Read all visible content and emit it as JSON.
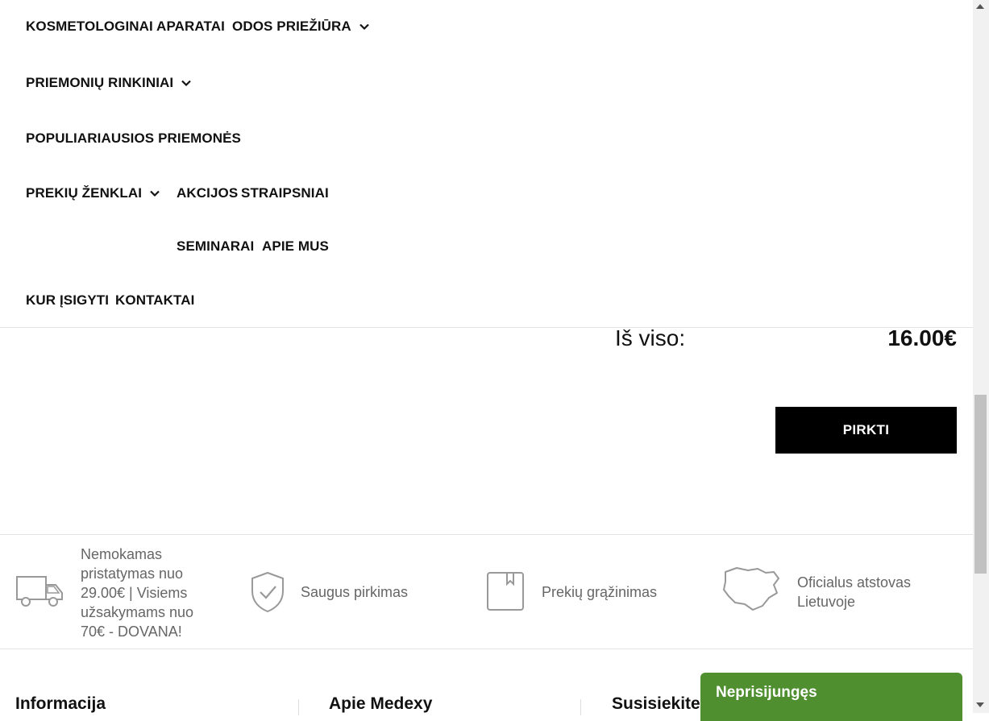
{
  "nav": {
    "items": [
      {
        "label": "KOSMETOLOGINAI APARATAI"
      },
      {
        "label": "ODOS PRIEŽIŪRA"
      },
      {
        "label": "PRIEMONIŲ RINKINIAI"
      },
      {
        "label": "POPULIARIAUSIOS PRIEMONĖS"
      },
      {
        "label": "PREKIŲ ŽENKLAI"
      },
      {
        "label": "AKCIJOS"
      },
      {
        "label": "STRAIPSNIAI"
      },
      {
        "label": "SEMINARAI"
      },
      {
        "label": "APIE MUS"
      },
      {
        "label": "KUR ĮSIGYTI"
      },
      {
        "label": "KONTAKTAI"
      }
    ]
  },
  "cart": {
    "total_label": "Iš viso:",
    "total_value": "16.00€",
    "buy_label": "PIRKTI"
  },
  "benefits": [
    {
      "icon": "delivery-truck-icon",
      "text": "Nemokamas pristatymas nuo 29.00€ | Visiems užsakymams nuo 70€ - DOVANA!"
    },
    {
      "icon": "shield-check-icon",
      "text": "Saugus pirkimas"
    },
    {
      "icon": "box-return-icon",
      "text": "Prekių grąžinimas"
    },
    {
      "icon": "lithuania-map-icon",
      "text": "Oficialus atstovas Lietuvoje"
    }
  ],
  "footer": {
    "columns": [
      {
        "title": "Informacija"
      },
      {
        "title": "Apie Medexy"
      },
      {
        "title": "Susisiekite"
      }
    ]
  },
  "chat": {
    "label": "Neprisijungęs",
    "color": "#4f8f2f"
  }
}
